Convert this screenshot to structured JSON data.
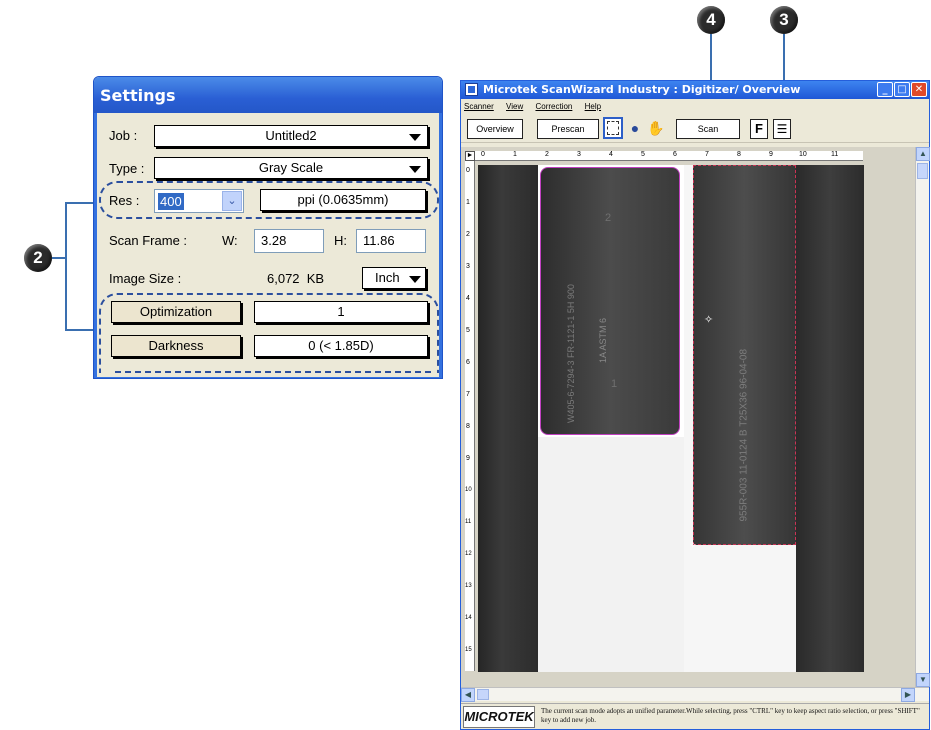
{
  "callouts": {
    "c2": "2",
    "c3": "3",
    "c4": "4"
  },
  "settings": {
    "title": "Settings",
    "job_label": "Job :",
    "job_value": "Untitled2",
    "type_label": "Type :",
    "type_value": "Gray Scale",
    "res_label": "Res :",
    "res_value": "400",
    "res_unit": "ppi (0.0635mm)",
    "scan_frame_label": "Scan Frame :",
    "w_label": "W:",
    "w_value": "3.28",
    "h_label": "H:",
    "h_value": "11.86",
    "image_size_label": "Image Size :",
    "image_size_value": "6,072  KB",
    "unit_value": "Inch",
    "optimization_button": "Optimization",
    "optimization_value": "1",
    "darkness_button": "Darkness",
    "darkness_value": "0 (< 1.85D)"
  },
  "window": {
    "title": "Microtek ScanWizard Industry : Digitizer/ Overview",
    "menu": [
      "Scanner",
      "View",
      "Correction",
      "Help"
    ],
    "toolbar": {
      "overview": "Overview",
      "prescan": "Prescan",
      "scan": "Scan",
      "f": "F"
    },
    "ruler_h": [
      "0",
      "1",
      "2",
      "3",
      "4",
      "5",
      "6",
      "7",
      "8",
      "9",
      "10",
      "11"
    ],
    "ruler_v": [
      "0",
      "1",
      "2",
      "3",
      "4",
      "5",
      "6",
      "7",
      "8",
      "9",
      "10",
      "11",
      "12",
      "13",
      "14",
      "15"
    ],
    "film_text_1": "W405-6-7294-3  FR-1121-1  5H 900",
    "film_text_2": "1A ASTM 6",
    "film_text_3": "2",
    "film_text_4": "1",
    "film_text_5": "955R-003 11-0124 B  T25X36  96-04-08",
    "logo": "MICROTEK",
    "status_text": "The current scan mode adopts an unified parameter.While selecting, press \"CTRL\" key to keep aspect ratio selection, or press \"SHIFT\" key to add new job."
  }
}
